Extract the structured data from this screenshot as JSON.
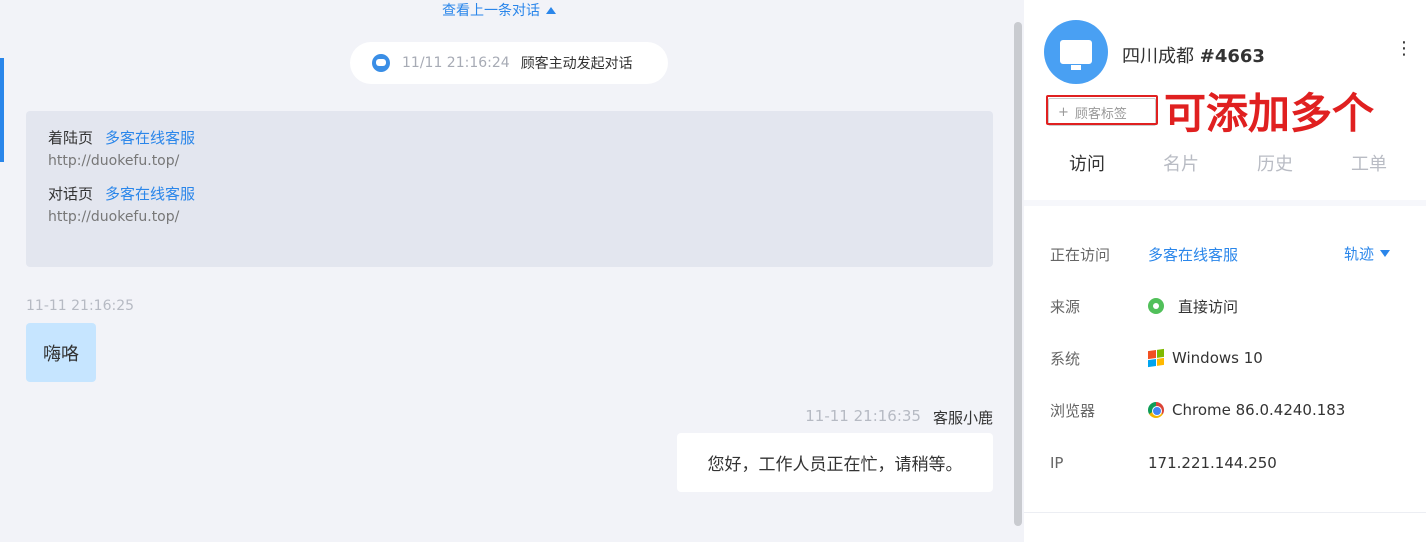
{
  "chat": {
    "prev_link": "查看上一条对话",
    "system_message": {
      "time": "11/11 21:16:24",
      "text": "顾客主动发起对话"
    },
    "info": [
      {
        "label": "着陆页",
        "title": "多客在线客服",
        "url": "http://duokefu.top/"
      },
      {
        "label": "对话页",
        "title": "多客在线客服",
        "url": "http://duokefu.top/"
      }
    ],
    "messages": [
      {
        "time": "11-11 21:16:25",
        "text": "嗨咯"
      },
      {
        "time": "11-11 21:16:35",
        "sender": "客服小鹿",
        "text": "您好，工作人员正在忙，请稍等。"
      }
    ]
  },
  "visitor": {
    "name": "四川成都",
    "id": "#4663",
    "tag_button": "顾客标签",
    "annotation": "可添加多个"
  },
  "tabs": [
    "访问",
    "名片",
    "历史",
    "工单"
  ],
  "details": {
    "visiting_label": "正在访问",
    "visiting_value": "多客在线客服",
    "trail": "轨迹",
    "source_label": "来源",
    "source_value": "直接访问",
    "system_label": "系统",
    "system_value": "Windows 10",
    "browser_label": "浏览器",
    "browser_value": "Chrome 86.0.4240.183",
    "ip_label": "IP",
    "ip_value": "171.221.144.250"
  },
  "colors": {
    "accent": "#2a86ea",
    "annotation_red": "#e02020",
    "bubble_visitor": "#c6e5ff"
  }
}
